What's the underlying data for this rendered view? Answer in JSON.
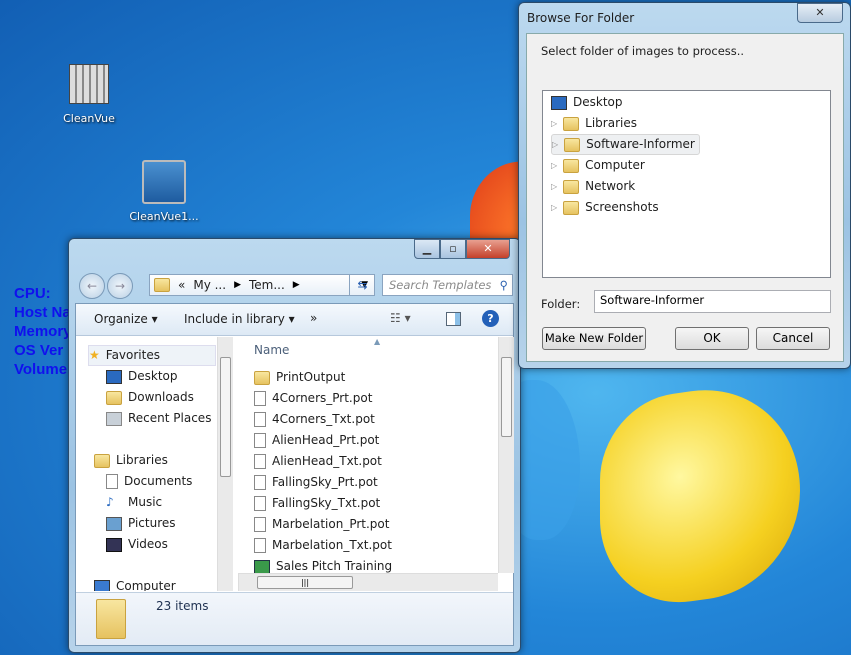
{
  "desktop": {
    "icons": [
      {
        "label": "CleanVue"
      },
      {
        "label": "CleanVue1..."
      }
    ],
    "sysinfo": [
      "CPU:",
      "Host Na",
      "Memory",
      "OS Ver",
      "Volume"
    ]
  },
  "explorer": {
    "breadcrumb": {
      "prefix": "«",
      "parts": [
        "My ...",
        "Tem..."
      ]
    },
    "search_placeholder": "Search Templates",
    "toolbar": {
      "organize": "Organize",
      "include": "Include in library",
      "more": "»"
    },
    "nav": {
      "favorites": "Favorites",
      "fav_items": [
        "Desktop",
        "Downloads",
        "Recent Places"
      ],
      "libraries": "Libraries",
      "lib_items": [
        "Documents",
        "Music",
        "Pictures",
        "Videos"
      ],
      "computer": "Computer"
    },
    "column_name": "Name",
    "files": [
      {
        "name": "PrintOutput",
        "type": "folder"
      },
      {
        "name": "4Corners_Prt.pot",
        "type": "file"
      },
      {
        "name": "4Corners_Txt.pot",
        "type": "file"
      },
      {
        "name": "AlienHead_Prt.pot",
        "type": "file"
      },
      {
        "name": "AlienHead_Txt.pot",
        "type": "file"
      },
      {
        "name": "FallingSky_Prt.pot",
        "type": "file"
      },
      {
        "name": "FallingSky_Txt.pot",
        "type": "file"
      },
      {
        "name": "Marbelation_Prt.pot",
        "type": "file"
      },
      {
        "name": "Marbelation_Txt.pot",
        "type": "file"
      },
      {
        "name": "Sales Pitch Training",
        "type": "cp"
      }
    ],
    "status": "23 items"
  },
  "browse": {
    "title": "Browse For Folder",
    "prompt": "Select folder of images to process..",
    "tree": {
      "root": "Desktop",
      "items": [
        "Libraries",
        "Software-Informer",
        "Computer",
        "Network",
        "Screenshots"
      ],
      "selected": "Software-Informer"
    },
    "folder_label": "Folder:",
    "folder_value": "Software-Informer",
    "buttons": {
      "new_folder": "Make New Folder",
      "ok": "OK",
      "cancel": "Cancel"
    }
  }
}
